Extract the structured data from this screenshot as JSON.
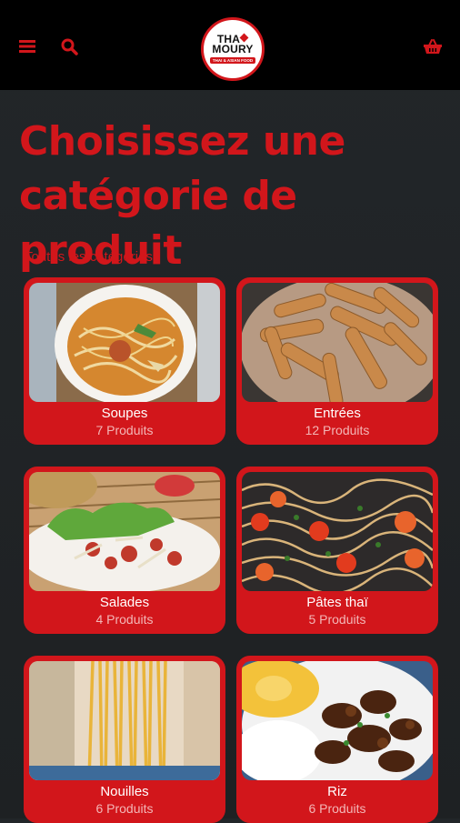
{
  "header": {
    "menu_icon": "hamburger-menu-icon",
    "search_icon": "search-icon",
    "cart_icon": "basket-icon",
    "logo": {
      "line1": "THA",
      "line2": "MOURY",
      "tagline": "THAI & ASIAN FOOD"
    }
  },
  "page": {
    "title": "Choisissez une catégorie de produit",
    "subtitle": "Toutes les catégories:"
  },
  "categories": [
    {
      "name": "Soupes",
      "count": "7 Produits"
    },
    {
      "name": "Entrées",
      "count": "12 Produits"
    },
    {
      "name": "Salades",
      "count": "4 Produits"
    },
    {
      "name": "Pâtes thaï",
      "count": "5 Produits"
    },
    {
      "name": "Nouilles",
      "count": "6 Produits"
    },
    {
      "name": "Riz",
      "count": "6 Produits"
    }
  ],
  "colors": {
    "accent": "#d2161b",
    "header": "#000000",
    "background": "#222629"
  }
}
